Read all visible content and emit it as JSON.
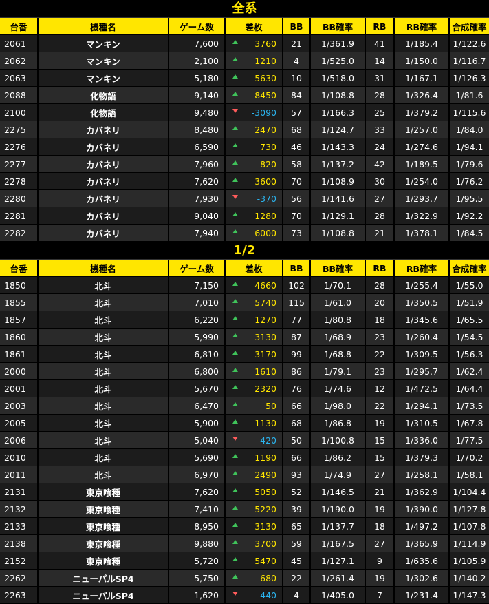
{
  "sections": [
    {
      "title": "全系",
      "headers": [
        "台番",
        "機種名",
        "ゲーム数",
        "差枚",
        "BB",
        "BB確率",
        "RB",
        "RB確率",
        "合成確率"
      ],
      "rows": [
        {
          "no": "2061",
          "name": "マンキン",
          "games": "7,600",
          "dir": "up",
          "diff": "3760",
          "bb": "21",
          "bbp": "1/361.9",
          "rb": "41",
          "rbp": "1/185.4",
          "total": "1/122.6"
        },
        {
          "no": "2062",
          "name": "マンキン",
          "games": "2,100",
          "dir": "up",
          "diff": "1210",
          "bb": "4",
          "bbp": "1/525.0",
          "rb": "14",
          "rbp": "1/150.0",
          "total": "1/116.7"
        },
        {
          "no": "2063",
          "name": "マンキン",
          "games": "5,180",
          "dir": "up",
          "diff": "5630",
          "bb": "10",
          "bbp": "1/518.0",
          "rb": "31",
          "rbp": "1/167.1",
          "total": "1/126.3"
        },
        {
          "no": "2088",
          "name": "化物語",
          "games": "9,140",
          "dir": "up",
          "diff": "8450",
          "bb": "84",
          "bbp": "1/108.8",
          "rb": "28",
          "rbp": "1/326.4",
          "total": "1/81.6"
        },
        {
          "no": "2100",
          "name": "化物語",
          "games": "9,480",
          "dir": "down",
          "diff": "-3090",
          "bb": "57",
          "bbp": "1/166.3",
          "rb": "25",
          "rbp": "1/379.2",
          "total": "1/115.6"
        },
        {
          "no": "2275",
          "name": "カバネリ",
          "games": "8,480",
          "dir": "up",
          "diff": "2470",
          "bb": "68",
          "bbp": "1/124.7",
          "rb": "33",
          "rbp": "1/257.0",
          "total": "1/84.0"
        },
        {
          "no": "2276",
          "name": "カバネリ",
          "games": "6,590",
          "dir": "up",
          "diff": "730",
          "bb": "46",
          "bbp": "1/143.3",
          "rb": "24",
          "rbp": "1/274.6",
          "total": "1/94.1"
        },
        {
          "no": "2277",
          "name": "カバネリ",
          "games": "7,960",
          "dir": "up",
          "diff": "820",
          "bb": "58",
          "bbp": "1/137.2",
          "rb": "42",
          "rbp": "1/189.5",
          "total": "1/79.6"
        },
        {
          "no": "2278",
          "name": "カバネリ",
          "games": "7,620",
          "dir": "up",
          "diff": "3600",
          "bb": "70",
          "bbp": "1/108.9",
          "rb": "30",
          "rbp": "1/254.0",
          "total": "1/76.2"
        },
        {
          "no": "2280",
          "name": "カバネリ",
          "games": "7,930",
          "dir": "down",
          "diff": "-370",
          "bb": "56",
          "bbp": "1/141.6",
          "rb": "27",
          "rbp": "1/293.7",
          "total": "1/95.5"
        },
        {
          "no": "2281",
          "name": "カバネリ",
          "games": "9,040",
          "dir": "up",
          "diff": "1280",
          "bb": "70",
          "bbp": "1/129.1",
          "rb": "28",
          "rbp": "1/322.9",
          "total": "1/92.2"
        },
        {
          "no": "2282",
          "name": "カバネリ",
          "games": "7,940",
          "dir": "up",
          "diff": "6000",
          "bb": "73",
          "bbp": "1/108.8",
          "rb": "21",
          "rbp": "1/378.1",
          "total": "1/84.5"
        }
      ]
    },
    {
      "title": "1/2",
      "headers": [
        "台番",
        "機種名",
        "ゲーム数",
        "差枚",
        "BB",
        "BB確率",
        "RB",
        "RB確率",
        "合成確率"
      ],
      "rows": [
        {
          "no": "1850",
          "name": "北斗",
          "games": "7,150",
          "dir": "up",
          "diff": "4660",
          "bb": "102",
          "bbp": "1/70.1",
          "rb": "28",
          "rbp": "1/255.4",
          "total": "1/55.0"
        },
        {
          "no": "1855",
          "name": "北斗",
          "games": "7,010",
          "dir": "up",
          "diff": "5740",
          "bb": "115",
          "bbp": "1/61.0",
          "rb": "20",
          "rbp": "1/350.5",
          "total": "1/51.9"
        },
        {
          "no": "1857",
          "name": "北斗",
          "games": "6,220",
          "dir": "up",
          "diff": "1270",
          "bb": "77",
          "bbp": "1/80.8",
          "rb": "18",
          "rbp": "1/345.6",
          "total": "1/65.5"
        },
        {
          "no": "1860",
          "name": "北斗",
          "games": "5,990",
          "dir": "up",
          "diff": "3130",
          "bb": "87",
          "bbp": "1/68.9",
          "rb": "23",
          "rbp": "1/260.4",
          "total": "1/54.5"
        },
        {
          "no": "1861",
          "name": "北斗",
          "games": "6,810",
          "dir": "up",
          "diff": "3170",
          "bb": "99",
          "bbp": "1/68.8",
          "rb": "22",
          "rbp": "1/309.5",
          "total": "1/56.3"
        },
        {
          "no": "2000",
          "name": "北斗",
          "games": "6,800",
          "dir": "up",
          "diff": "1610",
          "bb": "86",
          "bbp": "1/79.1",
          "rb": "23",
          "rbp": "1/295.7",
          "total": "1/62.4"
        },
        {
          "no": "2001",
          "name": "北斗",
          "games": "5,670",
          "dir": "up",
          "diff": "2320",
          "bb": "76",
          "bbp": "1/74.6",
          "rb": "12",
          "rbp": "1/472.5",
          "total": "1/64.4"
        },
        {
          "no": "2003",
          "name": "北斗",
          "games": "6,470",
          "dir": "up",
          "diff": "50",
          "bb": "66",
          "bbp": "1/98.0",
          "rb": "22",
          "rbp": "1/294.1",
          "total": "1/73.5"
        },
        {
          "no": "2005",
          "name": "北斗",
          "games": "5,900",
          "dir": "up",
          "diff": "1130",
          "bb": "68",
          "bbp": "1/86.8",
          "rb": "19",
          "rbp": "1/310.5",
          "total": "1/67.8"
        },
        {
          "no": "2006",
          "name": "北斗",
          "games": "5,040",
          "dir": "down",
          "diff": "-420",
          "bb": "50",
          "bbp": "1/100.8",
          "rb": "15",
          "rbp": "1/336.0",
          "total": "1/77.5"
        },
        {
          "no": "2010",
          "name": "北斗",
          "games": "5,690",
          "dir": "up",
          "diff": "1190",
          "bb": "66",
          "bbp": "1/86.2",
          "rb": "15",
          "rbp": "1/379.3",
          "total": "1/70.2"
        },
        {
          "no": "2011",
          "name": "北斗",
          "games": "6,970",
          "dir": "up",
          "diff": "2490",
          "bb": "93",
          "bbp": "1/74.9",
          "rb": "27",
          "rbp": "1/258.1",
          "total": "1/58.1"
        },
        {
          "no": "2131",
          "name": "東京喰種",
          "games": "7,620",
          "dir": "up",
          "diff": "5050",
          "bb": "52",
          "bbp": "1/146.5",
          "rb": "21",
          "rbp": "1/362.9",
          "total": "1/104.4"
        },
        {
          "no": "2132",
          "name": "東京喰種",
          "games": "7,410",
          "dir": "up",
          "diff": "5220",
          "bb": "39",
          "bbp": "1/190.0",
          "rb": "19",
          "rbp": "1/390.0",
          "total": "1/127.8"
        },
        {
          "no": "2133",
          "name": "東京喰種",
          "games": "8,950",
          "dir": "up",
          "diff": "3130",
          "bb": "65",
          "bbp": "1/137.7",
          "rb": "18",
          "rbp": "1/497.2",
          "total": "1/107.8"
        },
        {
          "no": "2138",
          "name": "東京喰種",
          "games": "9,880",
          "dir": "up",
          "diff": "3700",
          "bb": "59",
          "bbp": "1/167.5",
          "rb": "27",
          "rbp": "1/365.9",
          "total": "1/114.9"
        },
        {
          "no": "2152",
          "name": "東京喰種",
          "games": "5,720",
          "dir": "up",
          "diff": "5470",
          "bb": "45",
          "bbp": "1/127.1",
          "rb": "9",
          "rbp": "1/635.6",
          "total": "1/105.9"
        },
        {
          "no": "2262",
          "name": "ニューパルSP4",
          "games": "5,750",
          "dir": "up",
          "diff": "680",
          "bb": "22",
          "bbp": "1/261.4",
          "rb": "19",
          "rbp": "1/302.6",
          "total": "1/140.2"
        },
        {
          "no": "2263",
          "name": "ニューパルSP4",
          "games": "1,620",
          "dir": "down",
          "diff": "-440",
          "bb": "4",
          "bbp": "1/405.0",
          "rb": "7",
          "rbp": "1/231.4",
          "total": "1/147.3"
        }
      ]
    }
  ]
}
